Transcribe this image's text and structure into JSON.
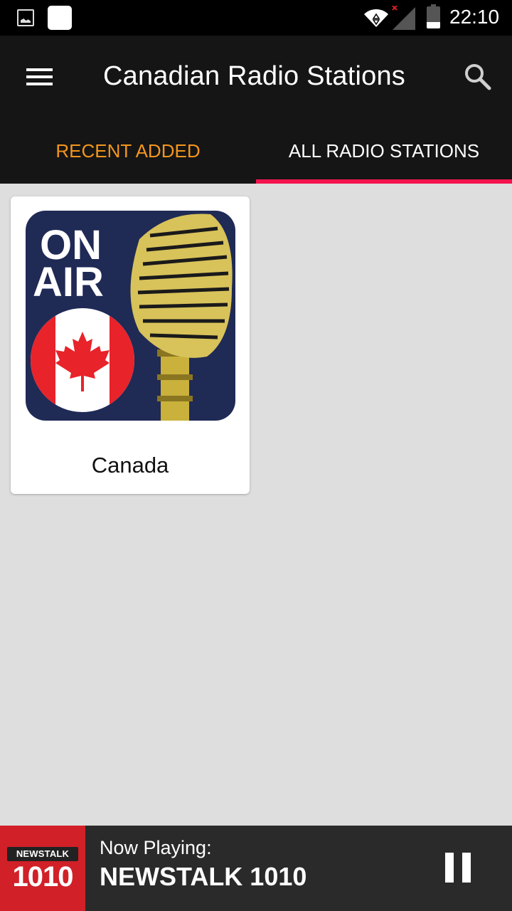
{
  "status_bar": {
    "icons": [
      "image-notification-icon",
      "app-notification-icon",
      "wifi-icon",
      "signal-icon",
      "battery-icon"
    ],
    "time": "22:10"
  },
  "app_bar": {
    "title": "Canadian Radio Stations",
    "menu_icon": "hamburger-menu-icon",
    "search_icon": "search-icon"
  },
  "tabs": [
    {
      "label": "RECENT ADDED",
      "selected": false
    },
    {
      "label": "ALL RADIO STATIONS",
      "selected": true
    }
  ],
  "colors": {
    "accent_orange": "#f3951d",
    "tab_indicator": "#f2134f",
    "app_bar_bg": "#151515",
    "content_bg": "#dedede",
    "player_bg": "#2a2a2a",
    "logo_red": "#d12027"
  },
  "grid": {
    "items": [
      {
        "label": "Canada",
        "image": "on-air-canada-microphone"
      }
    ]
  },
  "on_air_badge": {
    "line1": "ON",
    "line2": "AIR"
  },
  "player": {
    "logo_top": "NEWSTALK",
    "logo_number": "1010",
    "now_playing_label": "Now Playing:",
    "station_name": "NEWSTALK 1010",
    "control_icon": "pause-icon"
  }
}
